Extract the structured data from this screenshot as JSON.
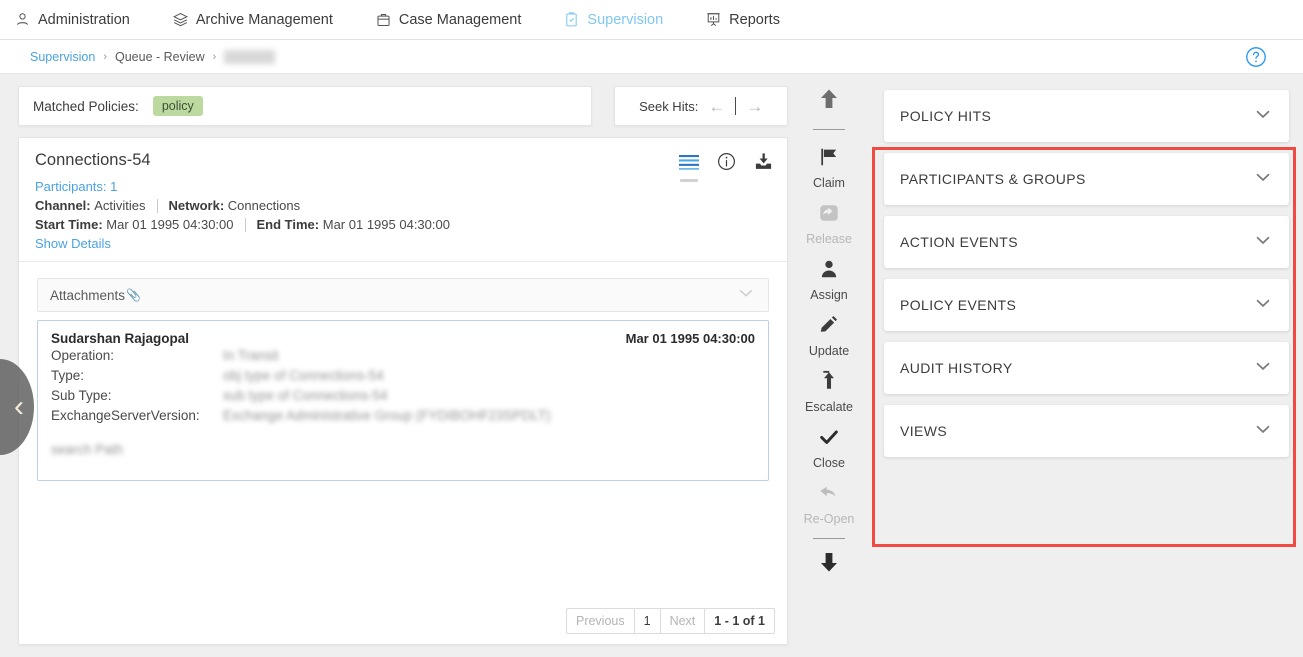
{
  "topnav": {
    "items": [
      {
        "label": "Administration",
        "icon": "user-admin-icon",
        "active": false
      },
      {
        "label": "Archive Management",
        "icon": "layers-icon",
        "active": false
      },
      {
        "label": "Case Management",
        "icon": "briefcase-icon",
        "active": false
      },
      {
        "label": "Supervision",
        "icon": "clipboard-check-icon",
        "active": true
      },
      {
        "label": "Reports",
        "icon": "chart-board-icon",
        "active": false
      }
    ]
  },
  "breadcrumb": {
    "items": [
      {
        "label": "Supervision",
        "link": true,
        "redacted": false
      },
      {
        "label": "Queue - Review",
        "link": false,
        "redacted": false
      },
      {
        "label": "Queue1",
        "link": false,
        "redacted": true
      }
    ],
    "separator": "›",
    "help_icon": "help-circle-icon"
  },
  "matched_policies": {
    "label": "Matched Policies:",
    "chips": [
      "policy"
    ],
    "chip_color": "#bcd9a0"
  },
  "seek_hits": {
    "label": "Seek Hits:",
    "prev_icon": "arrow-left-icon",
    "next_icon": "arrow-right-icon"
  },
  "detail": {
    "title": "Connections-54",
    "participants": "Participants: 1",
    "channel_label": "Channel:",
    "channel_value": "Activities",
    "network_label": "Network:",
    "network_value": "Connections",
    "start_label": "Start Time:",
    "start_value": "Mar 01 1995 04:30:00",
    "end_label": "End Time:",
    "end_value": "Mar 01 1995 04:30:00",
    "show_details": "Show Details",
    "icons": [
      {
        "name": "message-list-icon",
        "active": true
      },
      {
        "name": "info-circle-icon",
        "active": false
      },
      {
        "name": "download-icon",
        "active": false
      }
    ]
  },
  "attachments": {
    "label": "Attachments",
    "count": "0",
    "chevron_icon": "chevron-down-icon"
  },
  "message": {
    "author": "Sudarshan Rajagopal",
    "date": "Mar 01 1995 04:30:00",
    "fields": [
      {
        "key": "Operation:",
        "value": "In Transit"
      },
      {
        "key": "Type:",
        "value": "obj type of Connections-54"
      },
      {
        "key": "Sub Type:",
        "value": "sub type of Connections-54"
      },
      {
        "key": "ExchangeServerVersion:",
        "value": "Exchange Administrative Group (FYDIBOHF23SPDLT)"
      }
    ],
    "body": "search Path"
  },
  "pagination": {
    "previous": "Previous",
    "page": "1",
    "next": "Next",
    "range": "1 - 1 of 1"
  },
  "collapse": {
    "icon": "chevron-left-icon"
  },
  "rail": {
    "scroll_up_icon": "arrow-up-icon",
    "scroll_down_icon": "arrow-down-icon",
    "actions": [
      {
        "label": "Claim",
        "icon": "flag-icon",
        "disabled": false
      },
      {
        "label": "Release",
        "icon": "share-box-icon",
        "disabled": true
      },
      {
        "label": "Assign",
        "icon": "person-icon",
        "disabled": false
      },
      {
        "label": "Update",
        "icon": "pencil-icon",
        "disabled": false
      },
      {
        "label": "Escalate",
        "icon": "arrow-up-bar-icon",
        "disabled": false
      },
      {
        "label": "Close",
        "icon": "check-icon",
        "disabled": false
      },
      {
        "label": "Re-Open",
        "icon": "undo-arrow-icon",
        "disabled": true
      }
    ]
  },
  "accordion": {
    "items": [
      {
        "label": "POLICY HITS",
        "chevron": "chevron-down-icon"
      },
      {
        "label": "PARTICIPANTS & GROUPS",
        "chevron": "chevron-down-icon"
      },
      {
        "label": "ACTION EVENTS",
        "chevron": "chevron-down-icon"
      },
      {
        "label": "POLICY EVENTS",
        "chevron": "chevron-down-icon"
      },
      {
        "label": "AUDIT HISTORY",
        "chevron": "chevron-down-icon"
      },
      {
        "label": "VIEWS",
        "chevron": "chevron-down-icon"
      }
    ]
  },
  "annotation": {
    "color": "#f04a42"
  }
}
